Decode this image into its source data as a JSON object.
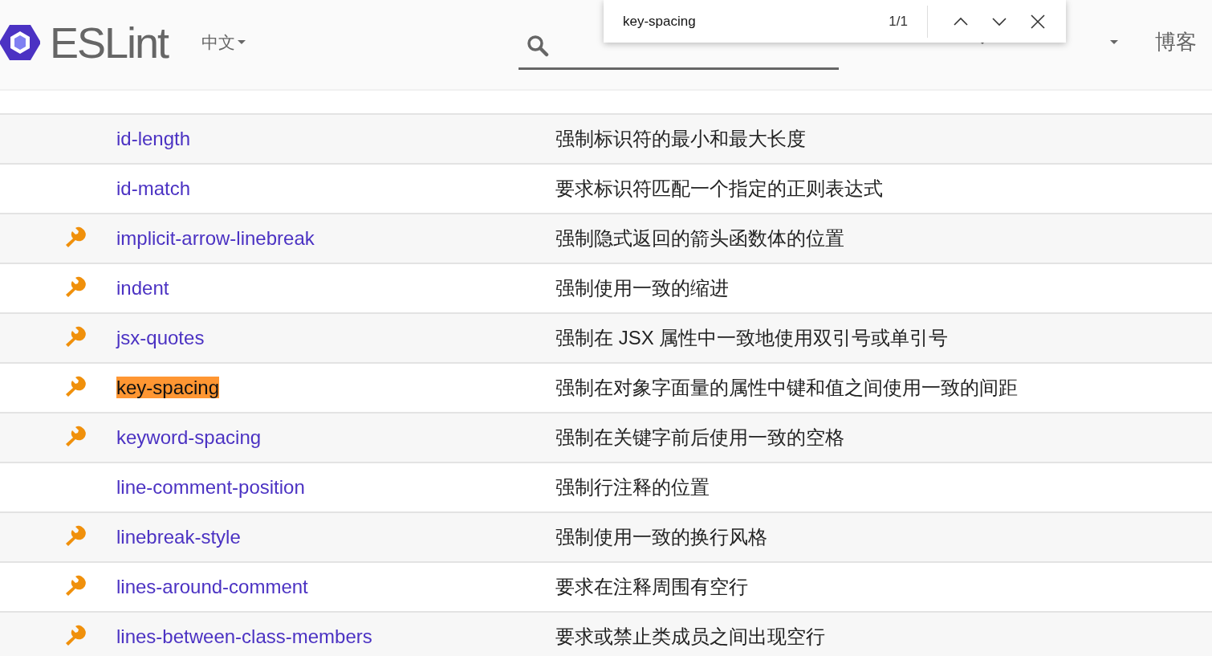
{
  "header": {
    "logo": "ESLint",
    "language": "中文",
    "nav": [
      {
        "dropdown": true
      },
      {
        "dropdown": true
      },
      {
        "label": "博客",
        "dropdown": false
      }
    ]
  },
  "find_bar": {
    "query": "key-spacing",
    "count": "1/1"
  },
  "rules": [
    {
      "name": "id-length",
      "description": "强制标识符的最小和最大长度",
      "fixable": false,
      "find_match": false
    },
    {
      "name": "id-match",
      "description": "要求标识符匹配一个指定的正则表达式",
      "fixable": false,
      "find_match": false
    },
    {
      "name": "implicit-arrow-linebreak",
      "description": "强制隐式返回的箭头函数体的位置",
      "fixable": true,
      "find_match": false
    },
    {
      "name": "indent",
      "description": "强制使用一致的缩进",
      "fixable": true,
      "find_match": false
    },
    {
      "name": "jsx-quotes",
      "description": "强制在 JSX 属性中一致地使用双引号或单引号",
      "fixable": true,
      "find_match": false
    },
    {
      "name": "key-spacing",
      "description": "强制在对象字面量的属性中键和值之间使用一致的间距",
      "fixable": true,
      "find_match": true
    },
    {
      "name": "keyword-spacing",
      "description": "强制在关键字前后使用一致的空格",
      "fixable": true,
      "find_match": false
    },
    {
      "name": "line-comment-position",
      "description": "强制行注释的位置",
      "fixable": false,
      "find_match": false
    },
    {
      "name": "linebreak-style",
      "description": "强制使用一致的换行风格",
      "fixable": true,
      "find_match": false
    },
    {
      "name": "lines-around-comment",
      "description": "要求在注释周围有空行",
      "fixable": true,
      "find_match": false
    },
    {
      "name": "lines-between-class-members",
      "description": "要求或禁止类成员之间出现空行",
      "fixable": true,
      "find_match": false
    }
  ]
}
